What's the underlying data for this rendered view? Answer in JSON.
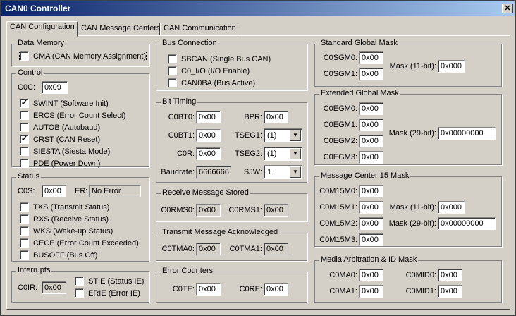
{
  "window": {
    "title": "CAN0 Controller",
    "close": "✕"
  },
  "tabs": [
    "CAN Configuration",
    "CAN Message Centers",
    "CAN Communication"
  ],
  "data_memory": {
    "title": "Data Memory",
    "cma": "CMA (CAN Memory Assignment)",
    "cma_checked": false
  },
  "control": {
    "title": "Control",
    "c0c_label": "C0C:",
    "c0c_value": "0x09",
    "items": [
      {
        "label": "SWINT (Software Init)",
        "checked": true
      },
      {
        "label": "ERCS (Error Count Select)",
        "checked": false
      },
      {
        "label": "AUTOB (Autobaud)",
        "checked": false
      },
      {
        "label": "CRST (CAN Reset)",
        "checked": true
      },
      {
        "label": "SIESTA (Siesta Mode)",
        "checked": false
      },
      {
        "label": "PDE (Power Down)",
        "checked": false
      }
    ]
  },
  "status": {
    "title": "Status",
    "c0s_label": "C0S:",
    "c0s_value": "0x00",
    "er_label": "ER:",
    "er_value": "No Error",
    "items": [
      {
        "label": "TXS (Transmit Status)",
        "checked": false
      },
      {
        "label": "RXS (Receive Status)",
        "checked": false
      },
      {
        "label": "WKS (Wake-up Status)",
        "checked": false
      },
      {
        "label": "CECE (Error Count Exceeded)",
        "checked": false
      },
      {
        "label": "BUSOFF (Bus Off)",
        "checked": false
      }
    ]
  },
  "interrupts": {
    "title": "Interrupts",
    "c0ir_label": "C0IR:",
    "c0ir_value": "0x00",
    "stie": "STIE (Status IE)",
    "erie": "ERIE (Error IE)"
  },
  "bus_connection": {
    "title": "Bus Connection",
    "items": [
      {
        "label": "SBCAN (Single Bus CAN)",
        "checked": false
      },
      {
        "label": "C0_I/O (I/O Enable)",
        "checked": false
      },
      {
        "label": "CAN0BA (Bus Active)",
        "checked": false
      }
    ]
  },
  "bit_timing": {
    "title": "Bit Timing",
    "c0bt0_label": "C0BT0:",
    "c0bt0": "0x00",
    "c0bt1_label": "C0BT1:",
    "c0bt1": "0x00",
    "c0r_label": "C0R:",
    "c0r": "0x00",
    "bpr_label": "BPR:",
    "bpr": "0x00",
    "tseg1_label": "TSEG1:",
    "tseg1": "(1)",
    "tseg2_label": "TSEG2:",
    "tseg2": "(1)",
    "sjw_label": "SJW:",
    "sjw": "1",
    "baud_label": "Baudrate:",
    "baud": "6666666"
  },
  "receive_stored": {
    "title": "Receive Message Stored",
    "l0": "C0RMS0:",
    "v0": "0x00",
    "l1": "C0RMS1:",
    "v1": "0x00"
  },
  "transmit_ack": {
    "title": "Transmit Message Acknowledged",
    "l0": "C0TMA0:",
    "v0": "0x00",
    "l1": "C0TMA1:",
    "v1": "0x00"
  },
  "error_counters": {
    "title": "Error Counters",
    "tel": "C0TE:",
    "te": "0x00",
    "rel": "C0RE:",
    "re": "0x00"
  },
  "std_mask": {
    "title": "Standard Global Mask",
    "l0": "C0SGM0:",
    "v0": "0x00",
    "l1": "C0SGM1:",
    "v1": "0x00",
    "mask_label": "Mask (11-bit):",
    "mask": "0x000"
  },
  "ext_mask": {
    "title": "Extended Global Mask",
    "l0": "C0EGM0:",
    "v0": "0x00",
    "l1": "C0EGM1:",
    "v1": "0x00",
    "l2": "C0EGM2:",
    "v2": "0x00",
    "l3": "C0EGM3:",
    "v3": "0x00",
    "mask_label": "Mask (29-bit):",
    "mask": "0x00000000"
  },
  "mc15_mask": {
    "title": "Message Center 15 Mask",
    "l0": "C0M15M0:",
    "v0": "0x00",
    "l1": "C0M15M1:",
    "v1": "0x00",
    "l2": "C0M15M2:",
    "v2": "0x00",
    "l3": "C0M15M3:",
    "v3": "0x00",
    "m11_label": "Mask (11-bit):",
    "m11": "0x000",
    "m29_label": "Mask (29-bit):",
    "m29": "0x00000000"
  },
  "media_arb": {
    "title": "Media Arbitration & ID Mask",
    "ma0l": "C0MA0:",
    "ma0": "0x00",
    "ma1l": "C0MA1:",
    "ma1": "0x00",
    "mid0l": "C0MID0:",
    "mid0": "0x00",
    "mid1l": "C0MID1:",
    "mid1": "0x00"
  }
}
